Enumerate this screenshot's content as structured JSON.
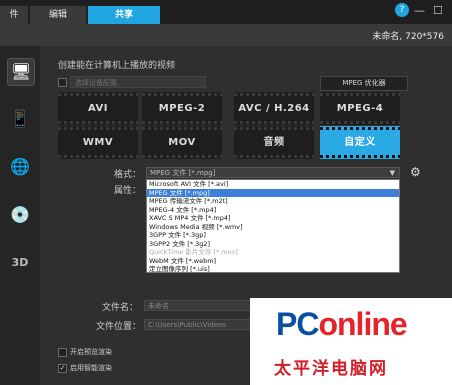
{
  "header": {
    "tabs": [
      {
        "label": "件"
      },
      {
        "label": "编辑"
      },
      {
        "label": "共享"
      }
    ],
    "help_glyph": "?",
    "minimize_glyph": "—",
    "maximize_glyph": "☐"
  },
  "statusbar": {
    "project_info": "未命名, 720*576"
  },
  "sidebar": {
    "items": [
      {
        "icon": "monitor-icon",
        "glyph": "🖥"
      },
      {
        "icon": "device-icon",
        "glyph": "📱"
      },
      {
        "icon": "globe-icon",
        "glyph": "🌐"
      },
      {
        "icon": "disc-icon",
        "glyph": "💿"
      },
      {
        "icon": "3d-icon",
        "glyph": "3D"
      }
    ]
  },
  "main": {
    "heading": "创建能在计算机上播放的视频",
    "dim_select": "选择设备配置",
    "mpeg_optimizer": "MPEG 优化器",
    "formats": [
      "AVI",
      "MPEG-2",
      "AVC / H.264",
      "MPEG-4",
      "WMV",
      "MOV",
      "音频",
      "自定义"
    ],
    "format_label": "格式：",
    "property_label": "属性：",
    "format_value": "MPEG 文件 [*.mpg]",
    "dropdown_options": [
      "Microsoft AVI 文件 [*.avi]",
      "MPEG 文件 [*.mpg]",
      "MPEG 传输流文件 [*.m2t]",
      "MPEG-4 文件 [*.mp4]",
      "XAVC S MP4 文件 [*.mp4]",
      "Windows Media 视频 [*.wmv]",
      "3GPP 文件 [*.3gp]",
      "3GPP2 文件 [*.3g2]",
      "QuickTime 影片文件 [*.mov]",
      "WebM 文件 [*.webm]",
      "定立图像序列 [*.uis]"
    ],
    "filename_label": "文件名：",
    "filename_value": "未命名",
    "location_label": "文件位置：",
    "location_value": "C:\\Users\\Public\\Videos",
    "opt1": "开启预览渲染",
    "opt2": "启用智能渲染"
  },
  "watermark": {
    "pc": "PC",
    "online": "online",
    "subtitle": "太平洋电脑网"
  },
  "colors": {
    "accent": "#1fa6e0",
    "selected_format": "#2ba9e5",
    "dropdown_selection": "#3b7fd6"
  }
}
